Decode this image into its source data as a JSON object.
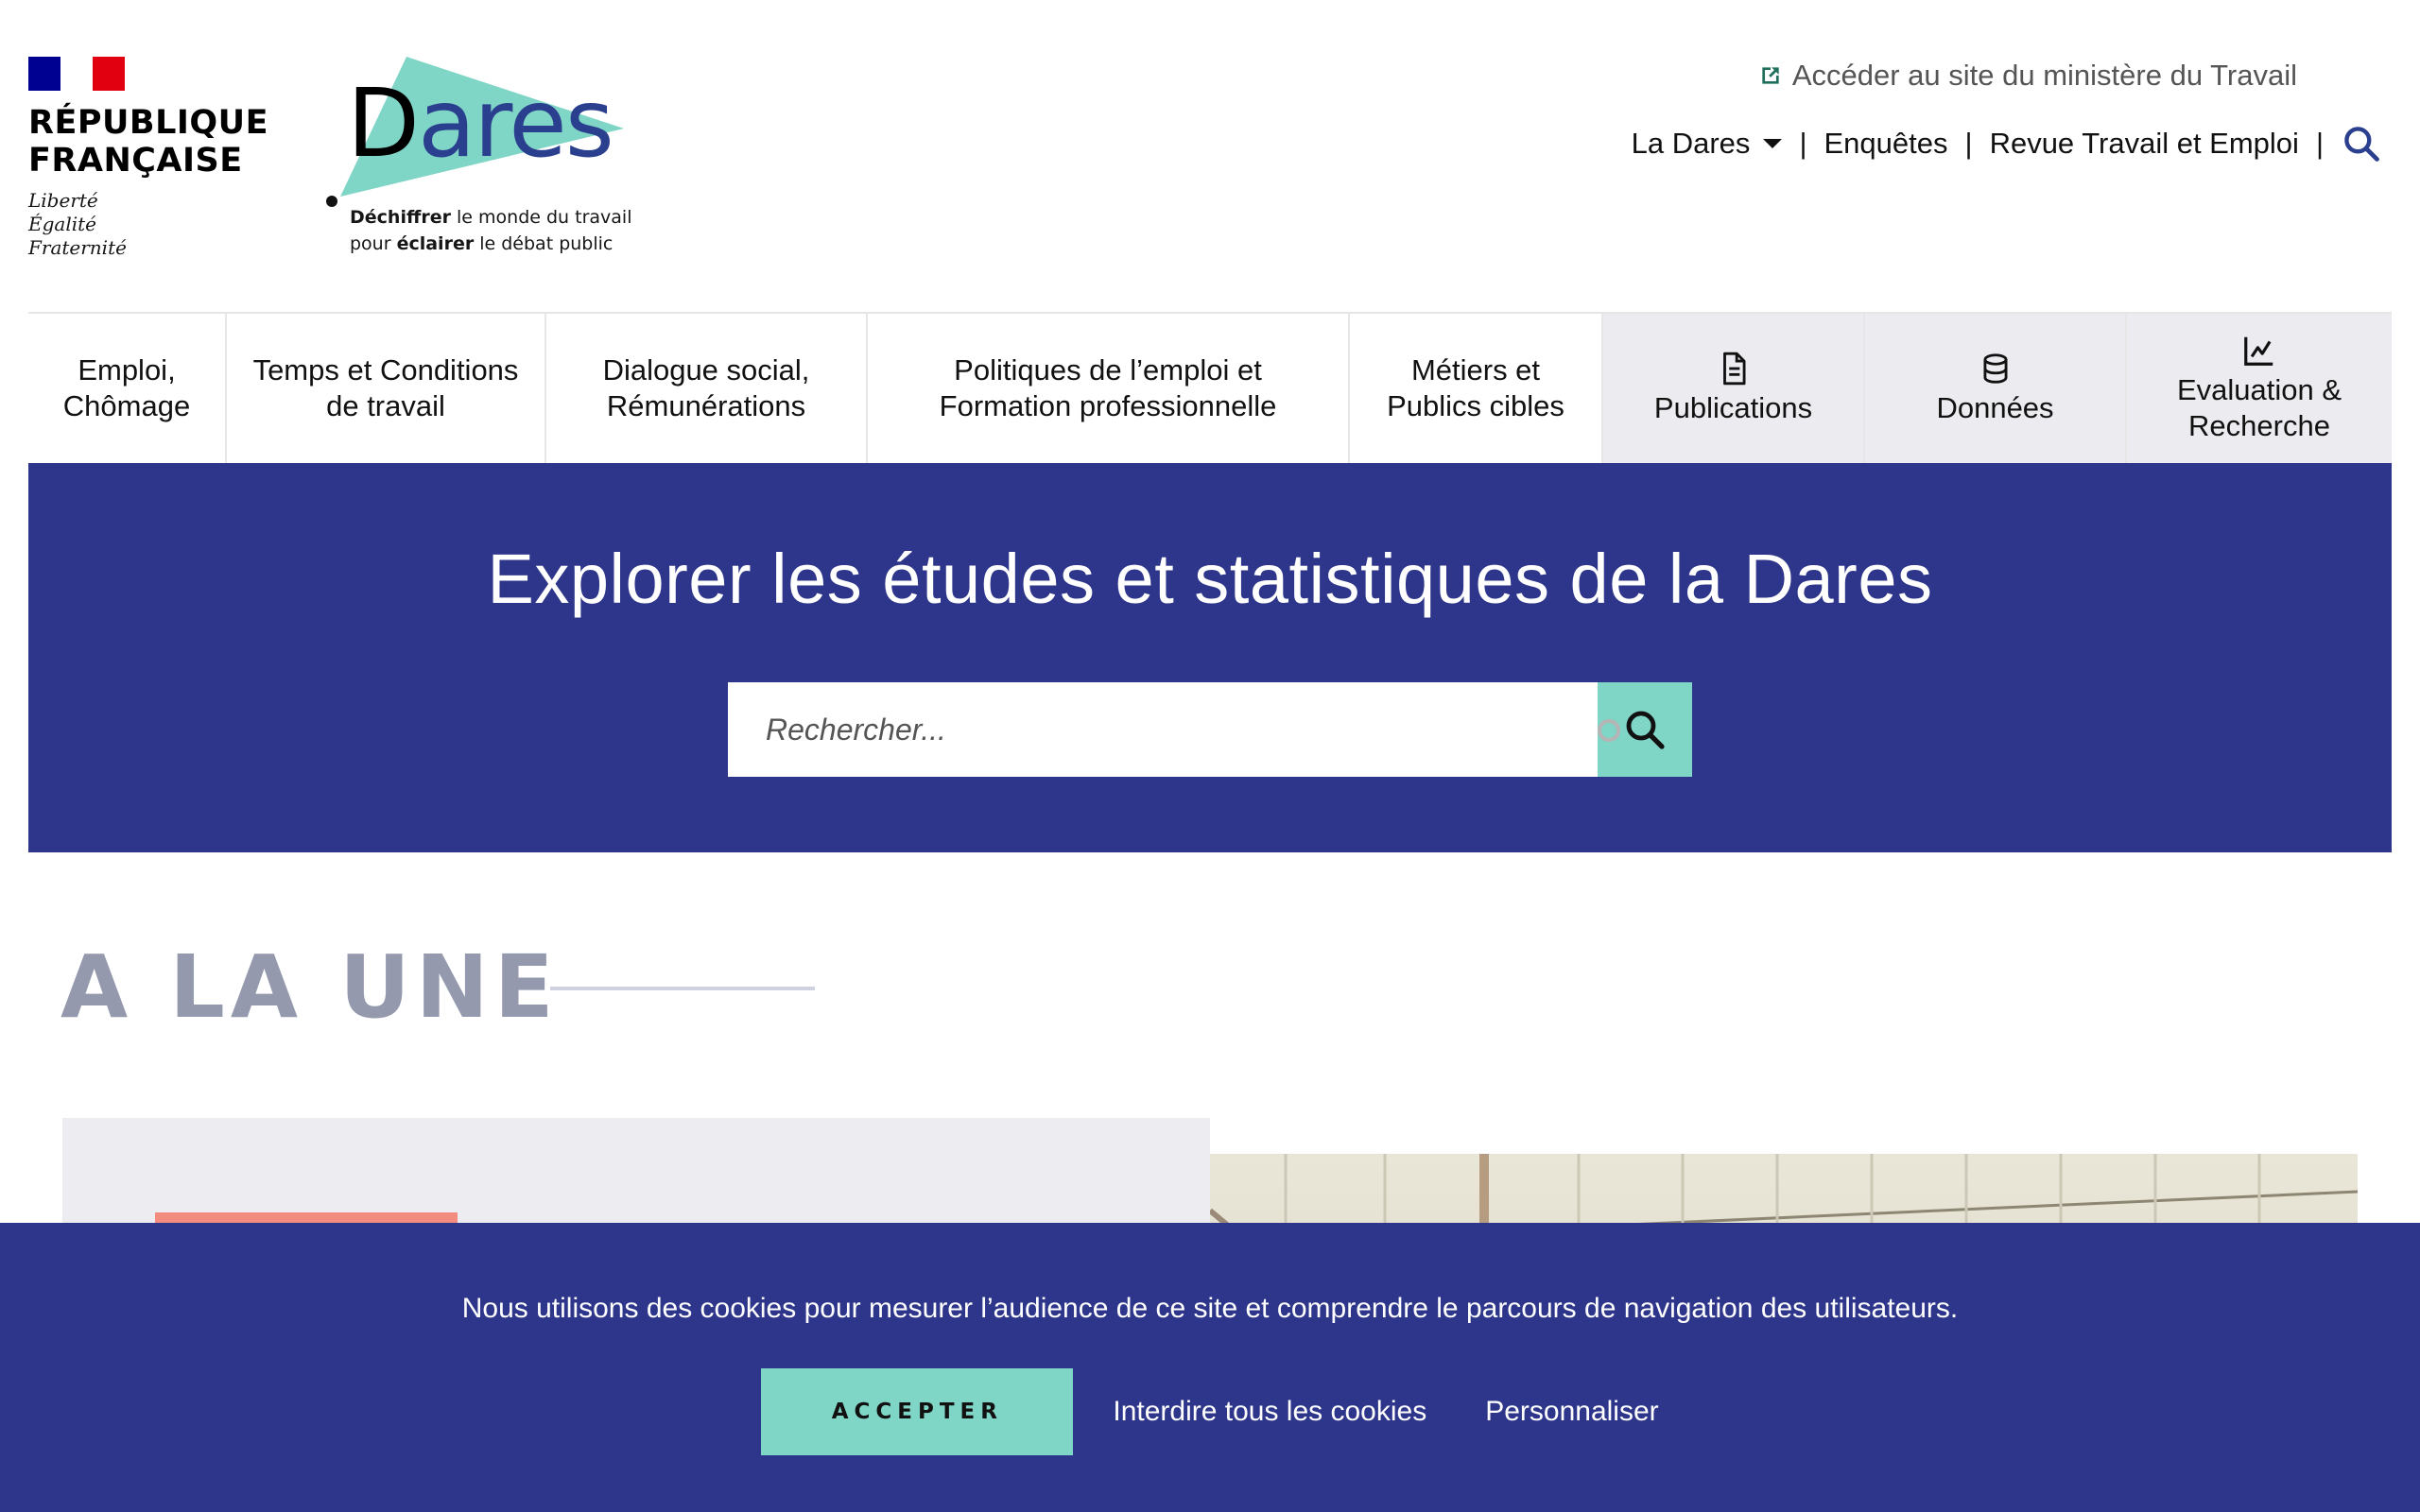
{
  "rf": {
    "name_line1": "RÉPUBLIQUE",
    "name_line2": "FRANÇAISE",
    "motto1": "Liberté",
    "motto2": "Égalité",
    "motto3": "Fraternité"
  },
  "logo": {
    "word_first": "D",
    "word_rest": "ares",
    "tag_bold1": "Déchiffrer",
    "tag_rest1": " le monde du travail",
    "tag_pre2": "pour ",
    "tag_bold2": "éclairer",
    "tag_rest2": " le débat public",
    "triangle_color": "#7fd5c6",
    "word_color": "#2b3f8f"
  },
  "header": {
    "external_link": "Accéder au site du ministère du Travail",
    "external_icon": "external-link-icon",
    "nav": [
      {
        "label": "La Dares"
      },
      {
        "label": "Enquêtes"
      },
      {
        "label": "Revue Travail et Emploi"
      }
    ],
    "separator": "|",
    "search_icon": "search-icon"
  },
  "main_nav": [
    {
      "line1": "Emploi,",
      "line2": "Chômage"
    },
    {
      "line1": "Temps et Conditions",
      "line2": "de travail"
    },
    {
      "line1": "Dialogue social,",
      "line2": "Rémunérations"
    },
    {
      "line1": "Politiques de l’emploi et",
      "line2": "Formation professionnelle"
    },
    {
      "line1": "Métiers et",
      "line2": "Publics cibles"
    },
    {
      "line1": "Publications",
      "icon": "document-icon"
    },
    {
      "line1": "Données",
      "icon": "database-icon"
    },
    {
      "line1": "Evaluation &",
      "line2": "Recherche",
      "icon": "chart-icon"
    }
  ],
  "hero": {
    "title": "Explorer les études et statistiques de la Dares",
    "search_placeholder": "Rechercher...",
    "background": "#2e368b",
    "button_color": "#7fd5c6"
  },
  "une": {
    "title": "A LA UNE"
  },
  "cookie": {
    "text": "Nous utilisons des cookies pour mesurer l’audience de ce site et comprendre le parcours de navigation des utilisateurs.",
    "accept": "ACCEPTER",
    "deny": "Interdire tous les cookies",
    "customize": "Personnaliser"
  }
}
